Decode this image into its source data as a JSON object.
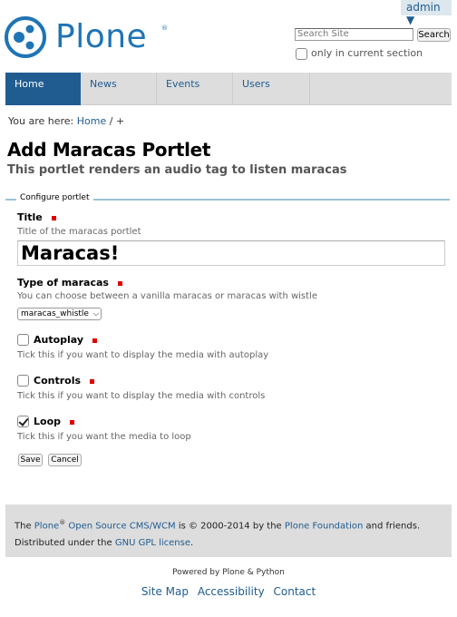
{
  "user": {
    "name": "admin ▼"
  },
  "logo": {
    "text": "Plone",
    "reg": "®"
  },
  "search": {
    "placeholder": "Search Site",
    "button": "Search",
    "only_current": "only in current section"
  },
  "nav": {
    "tabs": [
      "Home",
      "News",
      "Events",
      "Users"
    ]
  },
  "breadcrumb": {
    "prefix": "You are here:",
    "home": "Home",
    "sep": "/",
    "current": "+"
  },
  "page": {
    "title": "Add Maracas Portlet",
    "description": "This portlet renders an audio tag to listen maracas"
  },
  "form": {
    "legend": "Configure portlet",
    "title_label": "Title",
    "title_help": "Title of the maracas portlet",
    "title_value": "Maracas!",
    "type_label": "Type of maracas",
    "type_help": "You can choose between a vanilla maracas or maracas with wistle",
    "type_value": "maracas_whistle",
    "autoplay_label": "Autoplay",
    "autoplay_help": "Tick this if you want to display the media with autoplay",
    "autoplay_checked": false,
    "controls_label": "Controls",
    "controls_help": "Tick this if you want to display the media with controls",
    "controls_checked": false,
    "loop_label": "Loop",
    "loop_help": "Tick this if you want the media to loop",
    "loop_checked": true,
    "save": "Save",
    "cancel": "Cancel"
  },
  "footer": {
    "t1": "The ",
    "plone": "Plone",
    "reg": "®",
    "t2": " ",
    "cms": "Open Source CMS/WCM",
    "t3": " is © 2000-2014 by the ",
    "foundation": "Plone Foundation",
    "t4": " and friends. Distributed under the ",
    "license": "GNU GPL license",
    "t5": ".",
    "powered": "Powered by Plone & Python",
    "links": [
      "Site Map",
      "Accessibility",
      "Contact"
    ]
  },
  "colors": {
    "brand": "#1f74b5",
    "nav_active": "#205c90",
    "required": "#dd0000",
    "rule": "#9cc3d8"
  }
}
